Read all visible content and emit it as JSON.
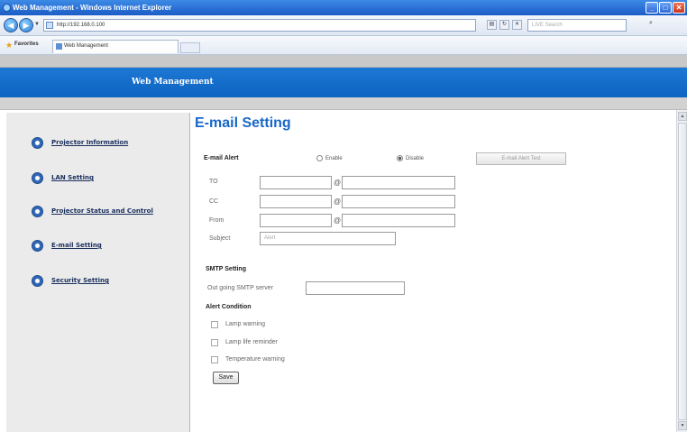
{
  "browser": {
    "window_title": "Web Management - Windows Internet Explorer",
    "url": "http://192.168.0.100",
    "search_placeholder": "LIVE Search",
    "favorites_label": "Favorites",
    "tab_title": "Web Management",
    "controls": {
      "minimize": "_",
      "maximize": "□",
      "close": "✕"
    }
  },
  "header": {
    "brand": "Web Management"
  },
  "sidebar": {
    "items": [
      {
        "label": "Projector Information"
      },
      {
        "label": "LAN Setting"
      },
      {
        "label": "Projector Status and Control"
      },
      {
        "label": "E-mail Setting",
        "selected": true
      },
      {
        "label": "Security Setting"
      }
    ]
  },
  "main": {
    "title": "E-mail Setting",
    "email_alert": {
      "label": "E-mail Alert",
      "enable_label": "Enable",
      "disable_label": "Disable",
      "selected": "Disable",
      "test_button": "E-mail Alert Test"
    },
    "fields": {
      "to_label": "TO",
      "cc_label": "CC",
      "from_label": "From",
      "subject_label": "Subject",
      "at_symbol": "@",
      "subject_value": "Alert"
    },
    "smtp": {
      "heading": "SMTP Setting",
      "server_label": "Out going SMTP server"
    },
    "alert_condition": {
      "heading": "Alert Condition",
      "options": [
        "Lamp warning",
        "Lamp life reminder",
        "Temperature warning"
      ]
    },
    "save_label": "Save"
  },
  "colors": {
    "header_blue": "#0d63c1",
    "title_blue": "#1767c8",
    "sidebar_bg": "#ebebeb",
    "nav_text": "#1a2f5c"
  }
}
